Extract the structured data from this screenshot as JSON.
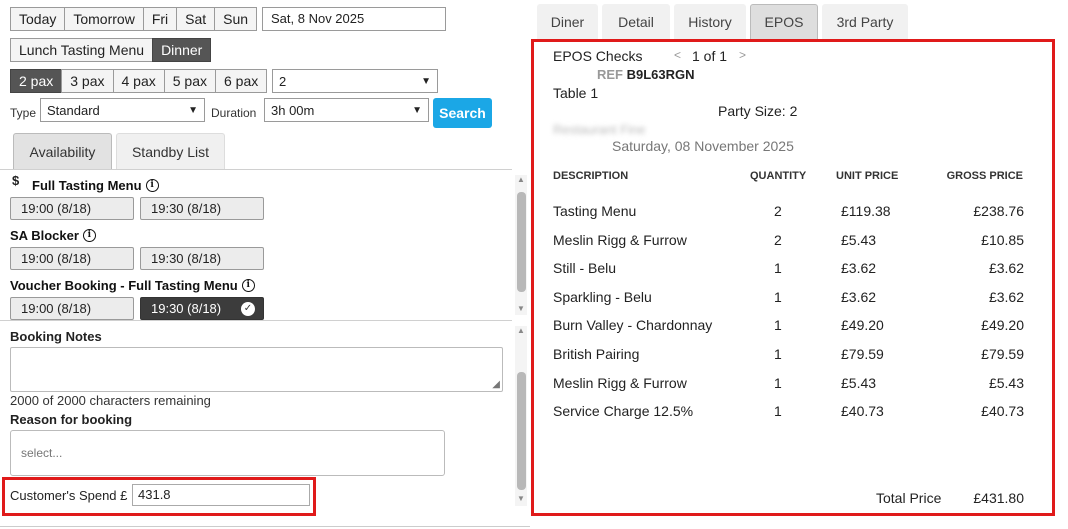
{
  "date_nav": {
    "buttons": [
      "Today",
      "Tomorrow",
      "Fri",
      "Sat",
      "Sun"
    ],
    "date_value": "Sat, 8 Nov 2025"
  },
  "menus": {
    "items": [
      "Lunch Tasting Menu",
      "Dinner"
    ],
    "active": "Dinner"
  },
  "pax": {
    "options": [
      "2 pax",
      "3 pax",
      "4 pax",
      "5 pax",
      "6 pax"
    ],
    "active": "2 pax",
    "select_value": "2"
  },
  "filters": {
    "type_label": "Type",
    "type_value": "Standard",
    "duration_label": "Duration",
    "duration_value": "3h 00m",
    "search_label": "Search"
  },
  "left_tabs": [
    "Availability",
    "Standby List"
  ],
  "availability": {
    "currency_symbol": "$",
    "groups": [
      {
        "title": "Full Tasting Menu",
        "slots": [
          "19:00 (8/18)",
          "19:30 (8/18)"
        ]
      },
      {
        "title": "SA Blocker",
        "slots": [
          "19:00 (8/18)",
          "19:30 (8/18)"
        ]
      },
      {
        "title": "Voucher Booking - Full Tasting Menu",
        "slots": [
          "19:00 (8/18)",
          "19:30 (8/18)"
        ]
      }
    ],
    "selected_slot": "19:30 (8/18)",
    "info_glyph": "i"
  },
  "notes": {
    "booking_notes_label": "Booking Notes",
    "chars_remaining": "2000 of 2000 characters remaining",
    "reason_label": "Reason for booking",
    "reason_placeholder": "select...",
    "spend_label": "Customer's Spend £",
    "spend_value": "431.8"
  },
  "right_tabs": [
    "Diner",
    "Detail",
    "History",
    "EPOS",
    "3rd Party"
  ],
  "right_active_tab": "EPOS",
  "epos": {
    "checks_label": "EPOS Checks",
    "prev": "<",
    "pager": "1 of 1",
    "next": ">",
    "ref_prefix": "REF",
    "ref": "B9L63RGN",
    "table": "Table 1",
    "party_size": "Party Size: 2",
    "restaurant": "Restaurant Fine",
    "date": "Saturday, 08 November 2025",
    "headers": [
      "DESCRIPTION",
      "QUANTITY",
      "UNIT PRICE",
      "GROSS PRICE"
    ],
    "rows": [
      {
        "desc": "Tasting Menu",
        "qty": "2",
        "unit": "£119.38",
        "gross": "£238.76"
      },
      {
        "desc": "Meslin Rigg & Furrow",
        "qty": "2",
        "unit": "£5.43",
        "gross": "£10.85"
      },
      {
        "desc": "Still - Belu",
        "qty": "1",
        "unit": "£3.62",
        "gross": "£3.62"
      },
      {
        "desc": "Sparkling - Belu",
        "qty": "1",
        "unit": "£3.62",
        "gross": "£3.62"
      },
      {
        "desc": "Burn Valley - Chardonnay",
        "qty": "1",
        "unit": "£49.20",
        "gross": "£49.20"
      },
      {
        "desc": "British Pairing",
        "qty": "1",
        "unit": "£79.59",
        "gross": "£79.59"
      },
      {
        "desc": "Meslin Rigg & Furrow",
        "qty": "1",
        "unit": "£5.43",
        "gross": "£5.43"
      },
      {
        "desc": "Service Charge 12.5%",
        "qty": "1",
        "unit": "£40.73",
        "gross": "£40.73"
      }
    ],
    "total_label": "Total Price",
    "total_value": "£431.80"
  },
  "colors": {
    "highlight_red": "#e01a1a",
    "search_blue": "#1ba7e6",
    "active_dark": "#555555"
  }
}
